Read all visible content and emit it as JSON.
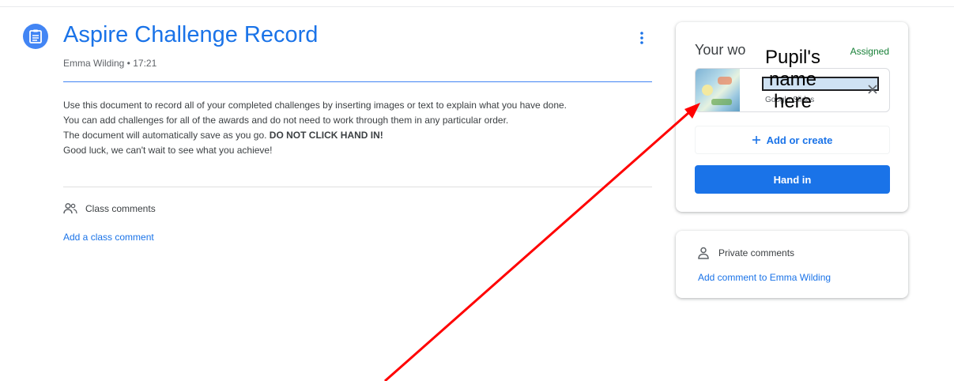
{
  "assignment": {
    "title": "Aspire Challenge Record",
    "meta": "Emma Wilding • 17:21",
    "icon": "assignment-icon",
    "accent_color": "#1a73e8",
    "description": {
      "line1": "Use this document to record all of your completed challenges by inserting images or text to explain what you have done.",
      "line2": "You can add challenges for all of the awards and do not need to work through them in any particular order.",
      "line3_prefix": "The document will automatically save as you go. ",
      "line3_bold": "DO NOT CLICK HAND IN!",
      "line4": "Good luck, we can't wait to see what you achieve!"
    }
  },
  "class_comments": {
    "label": "Class comments",
    "add_link": "Add a class comment"
  },
  "your_work": {
    "title": "Your wo",
    "status": "Assigned",
    "status_color": "#188038",
    "attachment": {
      "type": "Google Slides"
    },
    "add_create": "Add or create",
    "hand_in": "Hand in"
  },
  "annotation": {
    "line1": "Pupil's",
    "line2": "name",
    "line3": "here",
    "arrow_color": "#ff0000"
  },
  "private_comments": {
    "label": "Private comments",
    "add_link": "Add comment to Emma Wilding"
  }
}
